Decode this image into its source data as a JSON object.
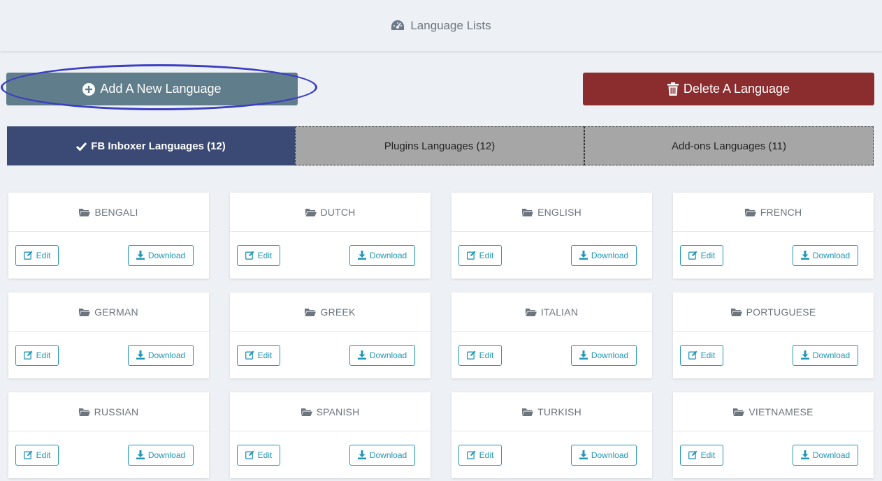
{
  "header": {
    "title": "Language Lists",
    "icon": "dashboard-gauge-icon"
  },
  "actions": {
    "add_label": "Add A New Language",
    "delete_label": "Delete A Language",
    "add_color": "#607d8b",
    "delete_color": "#8b2c2f"
  },
  "tabs": [
    {
      "label": "FB Inboxer Languages (12)",
      "active": true
    },
    {
      "label": "Plugins Languages (12)",
      "active": false
    },
    {
      "label": "Add-ons Languages (11)",
      "active": false
    }
  ],
  "card_buttons": {
    "edit": "Edit",
    "download": "Download"
  },
  "languages": [
    "BENGALI",
    "DUTCH",
    "ENGLISH",
    "FRENCH",
    "GERMAN",
    "GREEK",
    "ITALIAN",
    "PORTUGUESE",
    "RUSSIAN",
    "SPANISH",
    "TURKISH",
    "VIETNAMESE"
  ]
}
